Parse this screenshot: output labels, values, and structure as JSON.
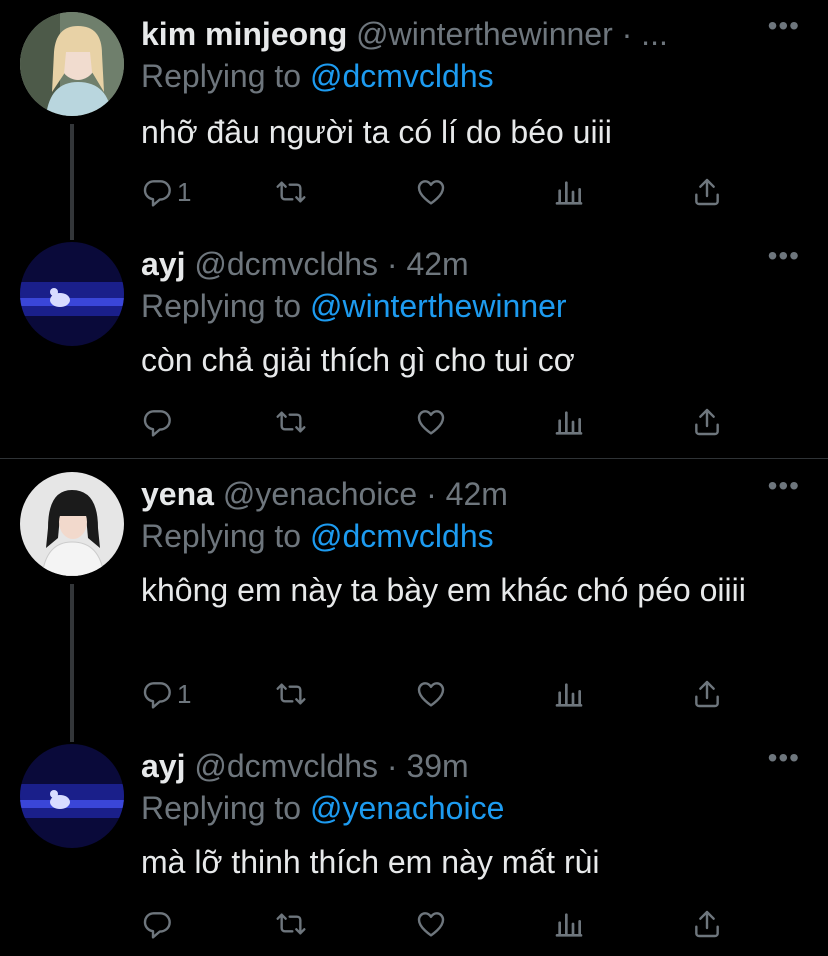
{
  "colors": {
    "background": "#000000",
    "text_primary": "#e7e9ea",
    "text_secondary": "#6e767d",
    "link": "#1d9bf0",
    "divider": "#2f3336"
  },
  "tweets": [
    {
      "name": "kim minjeong",
      "handle_line": "@winterthewinner · ...",
      "replying_label": "Replying to",
      "replying_to": "@dcmvcldhs",
      "text": "nhỡ đâu người ta có lí do béo uiii",
      "reply_count": "1",
      "avatar": "avatar-kim-minjeong"
    },
    {
      "name": "ayj",
      "handle_line": "@dcmvcldhs · 42m",
      "replying_label": "Replying to",
      "replying_to": "@winterthewinner",
      "text": "còn chả giải thích gì cho tui cơ",
      "reply_count": "",
      "avatar": "avatar-ayj"
    },
    {
      "name": "yena",
      "handle_line": "@yenachoice · 42m",
      "replying_label": "Replying to",
      "replying_to": "@dcmvcldhs",
      "text": "không em này ta bày em khác chó péo oiiii",
      "reply_count": "1",
      "avatar": "avatar-yena"
    },
    {
      "name": "ayj",
      "handle_line": "@dcmvcldhs · 39m",
      "replying_label": "Replying to",
      "replying_to": "@yenachoice",
      "text": "mà lỡ thinh thích em này mất rùi",
      "reply_count": "",
      "avatar": "avatar-ayj"
    }
  ],
  "more_glyph": "•••",
  "icons": [
    "reply-icon",
    "retweet-icon",
    "like-icon",
    "analytics-icon",
    "share-icon",
    "more-icon"
  ]
}
